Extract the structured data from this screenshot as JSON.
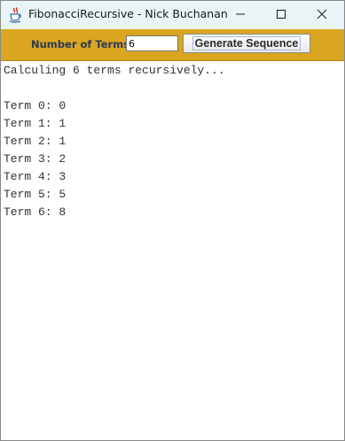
{
  "window": {
    "title": "FibonacciRecursive - Nick Buchanan",
    "app_icon": "java-cup-icon",
    "controls": [
      "minimize-icon",
      "maximize-icon",
      "close-icon"
    ]
  },
  "toolbar": {
    "terms_label": "Number of Terms:",
    "terms_value": "6",
    "generate_label": "Generate Sequence",
    "background_color": "#daa520"
  },
  "output": {
    "lines": [
      "Calculing 6 terms recursively...",
      "",
      "Term 0: 0",
      "Term 1: 1",
      "Term 2: 1",
      "Term 3: 2",
      "Term 4: 3",
      "Term 5: 5",
      "Term 6: 8"
    ]
  }
}
